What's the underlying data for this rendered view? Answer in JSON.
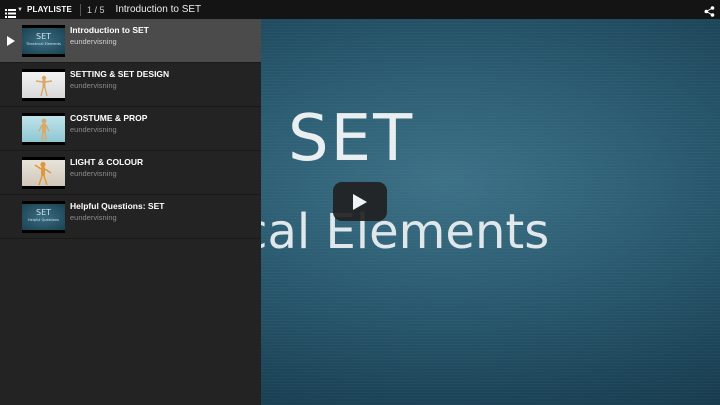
{
  "topbar": {
    "playlist_label": "PLAYLISTE",
    "counter": "1 / 5",
    "current_title": "Introduction to SET",
    "icons": [
      "list-icon",
      "share-icon"
    ]
  },
  "video": {
    "title_text": "SET",
    "subtitle_text": "rical Elements",
    "play_icon": "play-icon"
  },
  "playlist": {
    "items": [
      {
        "title": "Introduction to SET",
        "channel": "eundervisning",
        "thumb_title": "SET",
        "thumb_sub": "Theatrical Elements"
      },
      {
        "title": "SETTING & SET DESIGN",
        "channel": "eundervisning"
      },
      {
        "title": "COSTUME & PROP",
        "channel": "eundervisning"
      },
      {
        "title": "LIGHT & COLOUR",
        "channel": "eundervisning"
      },
      {
        "title": "Helpful Questions: SET",
        "channel": "eundervisning",
        "thumb_title": "SET",
        "thumb_sub": "Helpful Questions"
      }
    ]
  },
  "colors": {
    "panel_bg": "#232323",
    "active_item_bg": "#4b4b4b",
    "video_bg": "#2b5c72"
  }
}
